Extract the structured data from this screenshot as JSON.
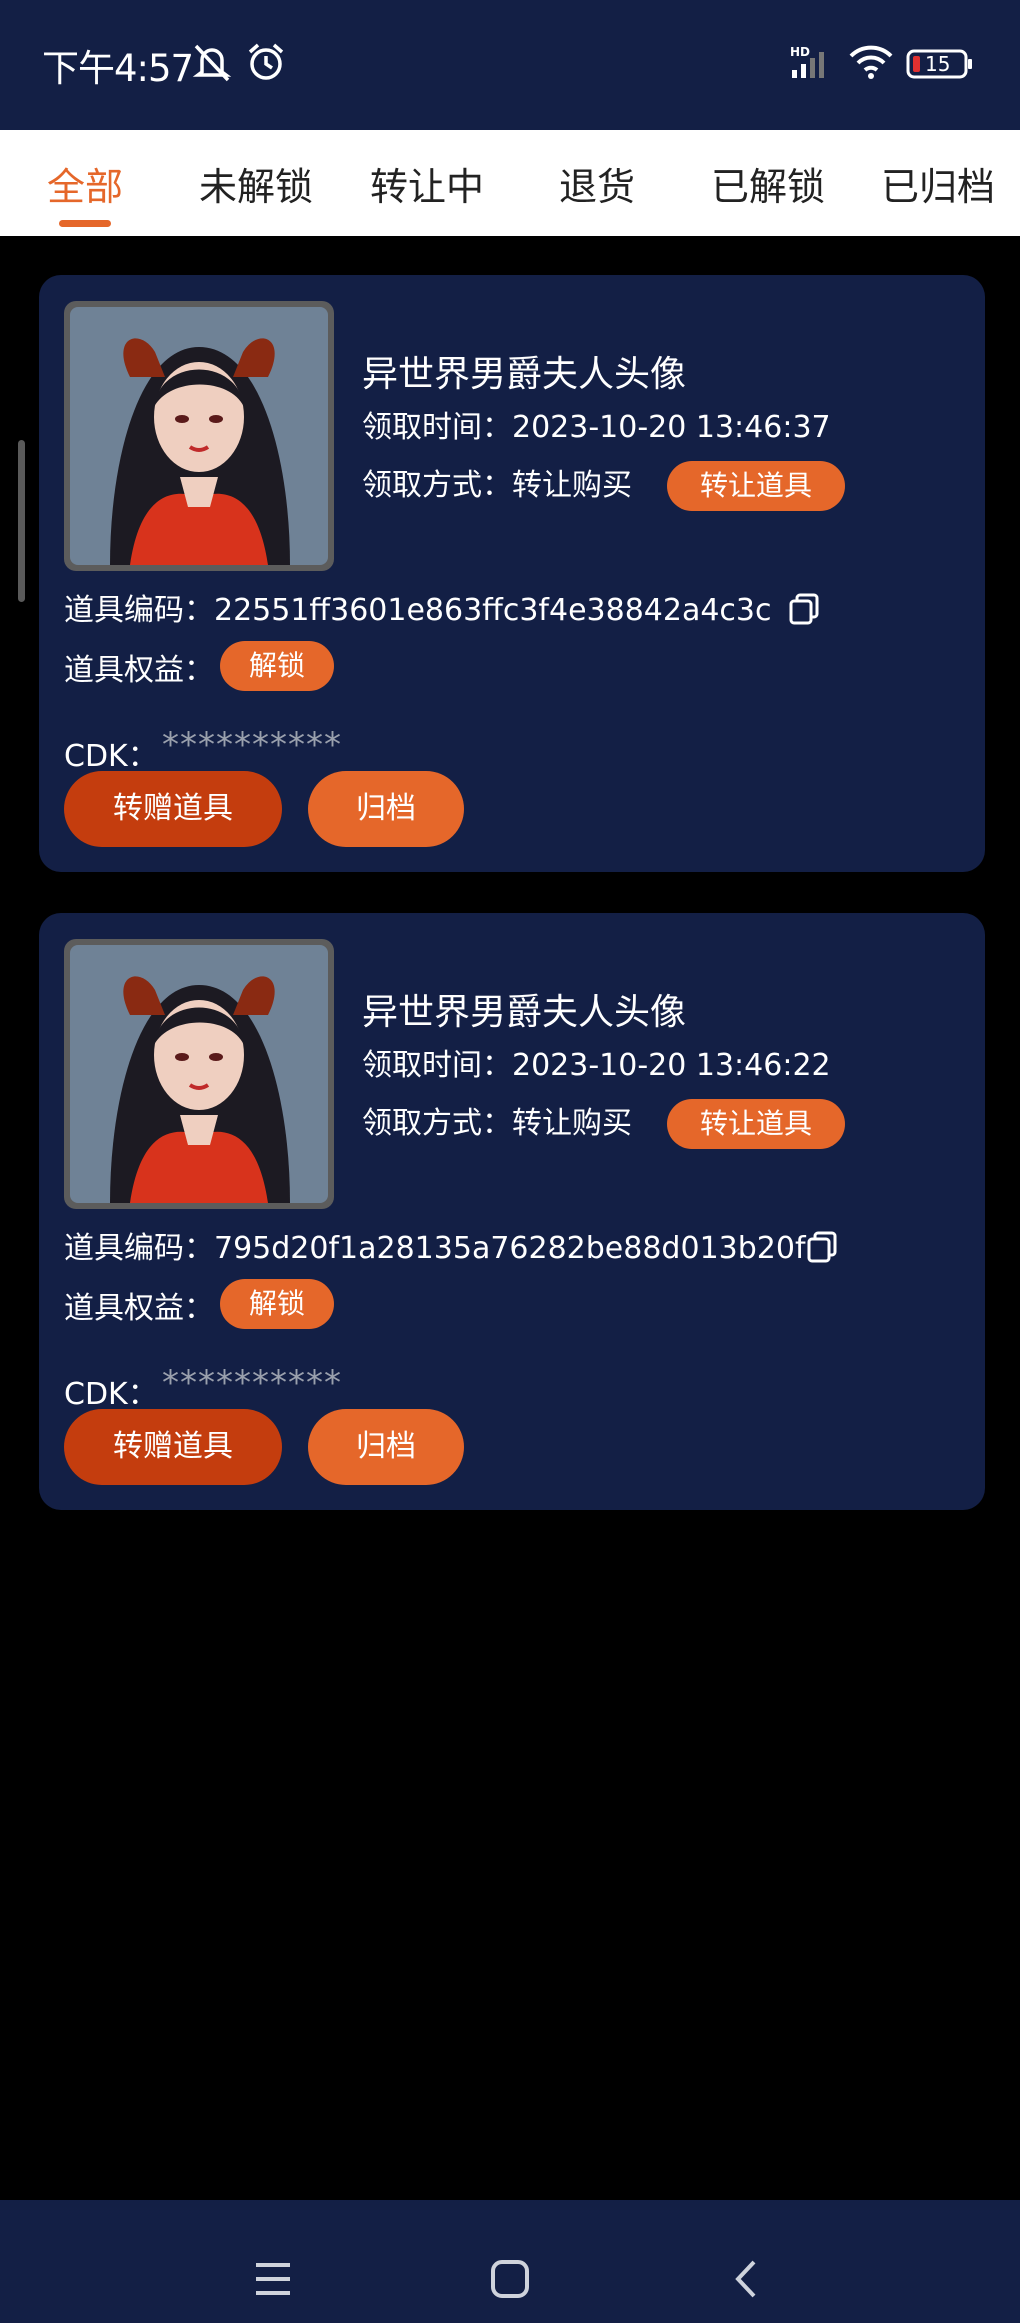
{
  "status_bar": {
    "time": "下午4:57",
    "icons": [
      "notifications-muted-icon",
      "alarm-icon",
      "hd-signal-icon",
      "wifi-icon",
      "battery-icon"
    ],
    "battery_level": "15"
  },
  "tabs": [
    {
      "label": "全部",
      "active": true
    },
    {
      "label": "未解锁",
      "active": false
    },
    {
      "label": "转让中",
      "active": false
    },
    {
      "label": "退货",
      "active": false
    },
    {
      "label": "已解锁",
      "active": false
    },
    {
      "label": "已归档",
      "active": false
    }
  ],
  "cards": [
    {
      "title": "异世界男爵夫人头像",
      "time_label": "领取时间：",
      "time_value": "2023-10-20 13:46:37",
      "method_label": "领取方式：",
      "method_value": "转让购买",
      "method_badge": "转让道具",
      "code_label": "道具编码：",
      "code_value": "22551ff3601e863ffc3f4e38842a4c3c",
      "rights_label": "道具权益：",
      "rights_badge": "解锁",
      "cdk_label": "CDK：",
      "cdk_value": "**********",
      "gift_button": "转赠道具",
      "archive_button": "归档"
    },
    {
      "title": "异世界男爵夫人头像",
      "time_label": "领取时间：",
      "time_value": "2023-10-20 13:46:22",
      "method_label": "领取方式：",
      "method_value": "转让购买",
      "method_badge": "转让道具",
      "code_label": "道具编码：",
      "code_value": "795d20f1a28135a76282be88d013b20f",
      "rights_label": "道具权益：",
      "rights_badge": "解锁",
      "cdk_label": "CDK：",
      "cdk_value": "**********",
      "gift_button": "转赠道具",
      "archive_button": "归档"
    }
  ],
  "nav_bar": {
    "icons": [
      "menu-icon",
      "home-icon",
      "back-icon"
    ]
  },
  "colors": {
    "accent": "#e5672a",
    "accent_dark": "#c43d0e",
    "card_bg": "#131f45",
    "page_bg": "#000000"
  }
}
